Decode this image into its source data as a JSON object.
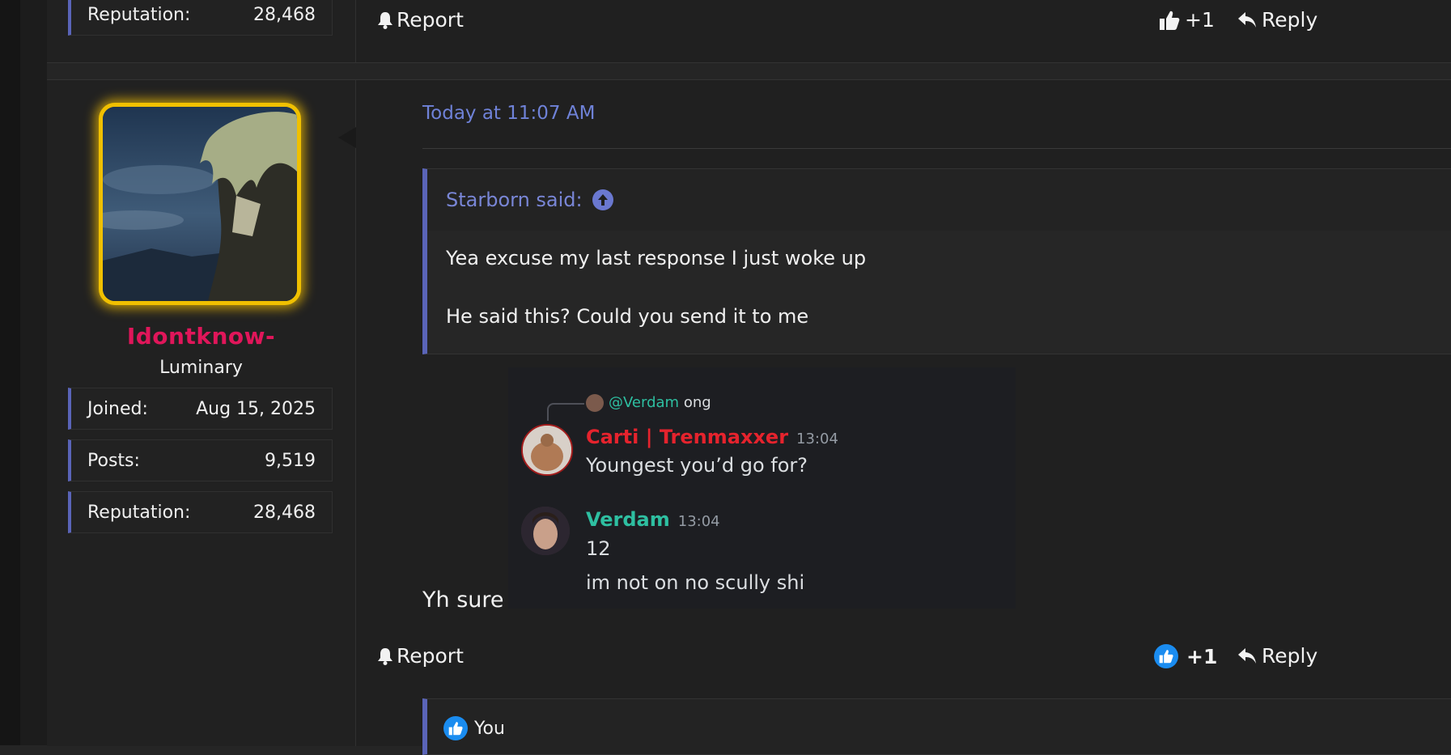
{
  "previous_post": {
    "stat": {
      "label": "Reputation:",
      "value": "28,468"
    },
    "actions": {
      "report": "Report",
      "like_count": "+1",
      "reply": "Reply"
    }
  },
  "post": {
    "user": {
      "name": "Idontknow-",
      "title": "Luminary",
      "stats": [
        {
          "label": "Joined:",
          "value": "Aug 15, 2025"
        },
        {
          "label": "Posts:",
          "value": "9,519"
        },
        {
          "label": "Reputation:",
          "value": "28,468"
        }
      ]
    },
    "timestamp": "Today at 11:07 AM",
    "quote": {
      "author": "Starborn said:",
      "lines": [
        "Yea excuse my last response I just woke up",
        "He said this? Could you send it to me"
      ]
    },
    "discord_image": {
      "reply_mention": "@Verdam",
      "reply_text": "ong",
      "messages": [
        {
          "author": "Carti | Trenmaxxer",
          "time": "13:04",
          "author_color": "#e5232d",
          "lines": [
            "Youngest you’d go for?"
          ]
        },
        {
          "author": "Verdam",
          "time": "13:04",
          "author_color": "#2ebfa1",
          "lines": [
            "12",
            "im not on no scully shi"
          ]
        }
      ]
    },
    "body_text": "Yh sure",
    "actions": {
      "report": "Report",
      "like_count": "+1",
      "reply": "Reply"
    },
    "reactions": {
      "label": "You"
    }
  },
  "colors": {
    "accent": "#5a64b8",
    "link": "#6f82d8",
    "username": "#e0165a",
    "avatar_glow": "#f0c000",
    "like_blue": "#1a8cf0"
  }
}
